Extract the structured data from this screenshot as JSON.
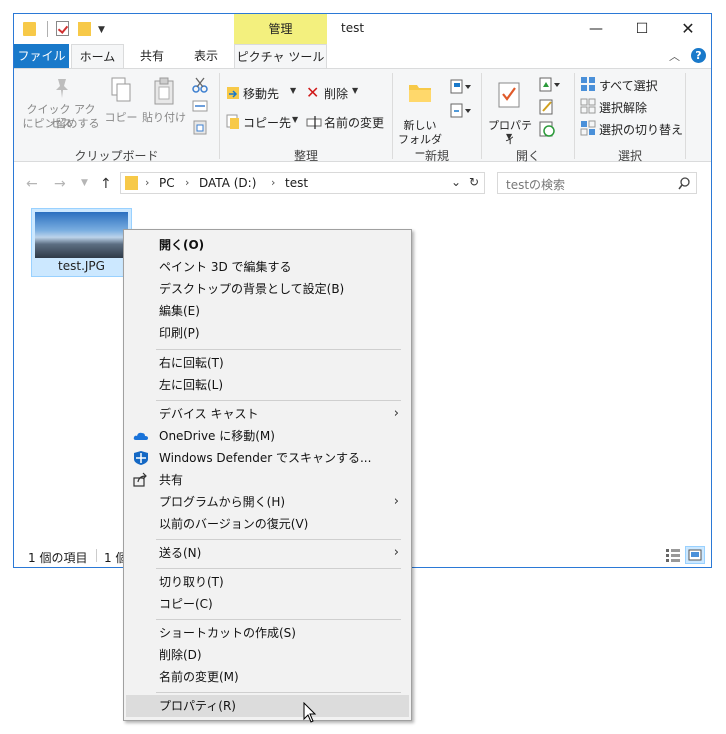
{
  "title_bar": {
    "context_tab_group": "管理",
    "window_title": "test",
    "minimize_glyph": "—",
    "maximize_glyph": "☐",
    "close_glyph": "✕"
  },
  "tabs": {
    "file": "ファイル",
    "home": "ホーム",
    "share": "共有",
    "view": "表示",
    "picture_tools": "ピクチャ ツール",
    "collapse_glyph": "︿",
    "help_glyph": "?"
  },
  "ribbon": {
    "clipboard": {
      "pin_label_1": "クイック アクセス",
      "pin_label_2": "にピン留めする",
      "copy": "コピー",
      "paste": "貼り付け",
      "group": "クリップボード"
    },
    "organize": {
      "move_to": "移動先",
      "copy_to": "コピー先",
      "delete": "削除",
      "rename": "名前の変更",
      "group": "整理"
    },
    "new": {
      "new_folder_1": "新しい",
      "new_folder_2": "フォルダー",
      "group": "新規"
    },
    "open": {
      "properties": "プロパティ",
      "group": "開く"
    },
    "select": {
      "select_all": "すべて選択",
      "select_none": "選択解除",
      "invert": "選択の切り替え",
      "group": "選択"
    }
  },
  "address": {
    "crumbs": [
      "PC",
      "DATA (D:)",
      "test"
    ],
    "search_placeholder": "testの検索"
  },
  "file": {
    "name": "test.JPG"
  },
  "status": {
    "item_count": "1 個の項目",
    "selected": "1 個"
  },
  "menu": {
    "open": "開く(O)",
    "paint3d": "ペイント 3D で編集する",
    "set_bg": "デスクトップの背景として設定(B)",
    "edit": "編集(E)",
    "print": "印刷(P)",
    "rotate_right": "右に回転(T)",
    "rotate_left": "左に回転(L)",
    "cast": "デバイス キャスト",
    "onedrive": "OneDrive に移動(M)",
    "defender": "Windows Defender でスキャンする...",
    "share": "共有",
    "open_with": "プログラムから開く(H)",
    "restore": "以前のバージョンの復元(V)",
    "send_to": "送る(N)",
    "cut": "切り取り(T)",
    "copy": "コピー(C)",
    "shortcut": "ショートカットの作成(S)",
    "delete": "削除(D)",
    "rename": "名前の変更(M)",
    "properties": "プロパティ(R)",
    "arrow_glyph": "›"
  },
  "colors": {
    "accent": "#1979ca",
    "context_tab": "#f3f07e",
    "selection": "#cce8ff"
  }
}
